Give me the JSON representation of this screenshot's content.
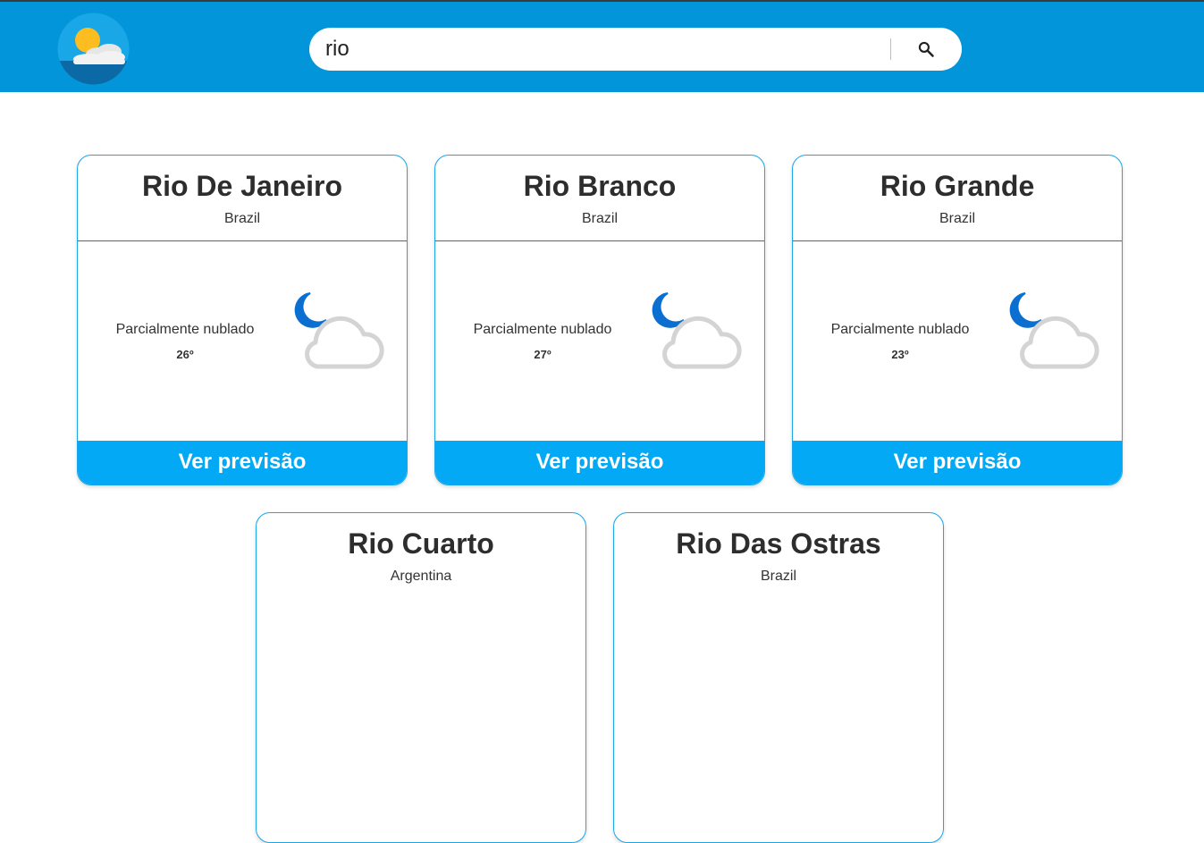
{
  "search": {
    "value": "rio",
    "placeholder": ""
  },
  "cards": [
    {
      "city": "Rio De Janeiro",
      "country": "Brazil",
      "condition": "Parcialmente nublado",
      "temp": "26º",
      "button": "Ver previsão"
    },
    {
      "city": "Rio Branco",
      "country": "Brazil",
      "condition": "Parcialmente nublado",
      "temp": "27º",
      "button": "Ver previsão"
    },
    {
      "city": "Rio Grande",
      "country": "Brazil",
      "condition": "Parcialmente nublado",
      "temp": "23º",
      "button": "Ver previsão"
    },
    {
      "city": "Rio Cuarto",
      "country": "Argentina"
    },
    {
      "city": "Rio Das Ostras",
      "country": "Brazil"
    }
  ],
  "icons": {
    "logo": "sun-cloud-logo",
    "search": "search-icon",
    "weather": "partly-cloudy-night-icon"
  },
  "colors": {
    "header": "#0395d9",
    "accent": "#03a9f4",
    "moon": "#0a6fd0",
    "cloud": "#d4d4d4"
  }
}
